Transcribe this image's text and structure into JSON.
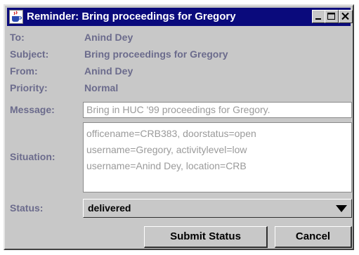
{
  "window": {
    "title": "Reminder: Bring proceedings for Gregory",
    "icon": "java-cup-icon"
  },
  "fields": {
    "to_label": "To:",
    "to_value": "Anind Dey",
    "subject_label": "Subject:",
    "subject_value": "Bring proceedings for Gregory",
    "from_label": "From:",
    "from_value": "Anind Dey",
    "priority_label": "Priority:",
    "priority_value": "Normal",
    "message_label": "Message:",
    "message_value": "Bring in HUC '99 proceedings for Gregory.",
    "situation_label": "Situation:",
    "situation_lines": [
      "officename=CRB383, doorstatus=open",
      "username=Gregory, activitylevel=low",
      "username=Anind Dey, location=CRB"
    ],
    "status_label": "Status:",
    "status_value": "delivered"
  },
  "buttons": {
    "submit": "Submit Status",
    "cancel": "Cancel"
  },
  "colors": {
    "titlebar": "#0a0a7c",
    "label": "#6b6b8c",
    "panel": "#c8c8c8"
  }
}
